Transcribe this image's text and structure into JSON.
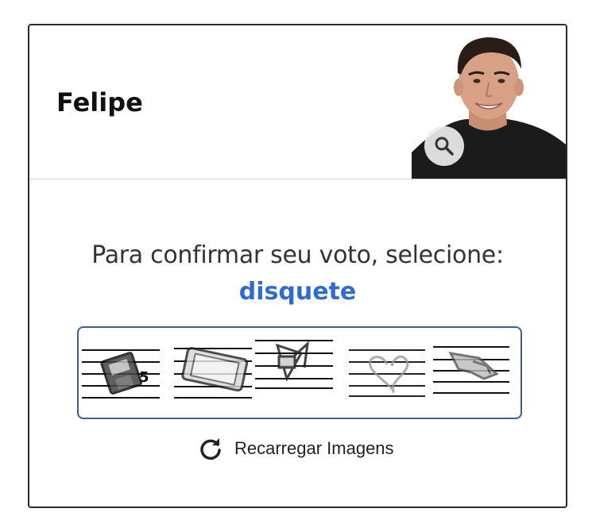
{
  "candidate": {
    "name": "Felipe"
  },
  "photo": {
    "zoom_icon": "magnifier-icon"
  },
  "captcha": {
    "prompt": "Para confirmar seu voto, selecione:",
    "target_word": "disquete",
    "tiles": [
      {
        "icon": "floppy-disk-icon"
      },
      {
        "icon": "phone-icon"
      },
      {
        "icon": "shapes-icon"
      },
      {
        "icon": "heart-icon"
      },
      {
        "icon": "hand-icon"
      }
    ],
    "reload_label": "Recarregar Imagens",
    "reload_icon": "reload-icon"
  },
  "colors": {
    "target_word": "#2f6bd1",
    "captcha_border": "#3a5f9a"
  }
}
